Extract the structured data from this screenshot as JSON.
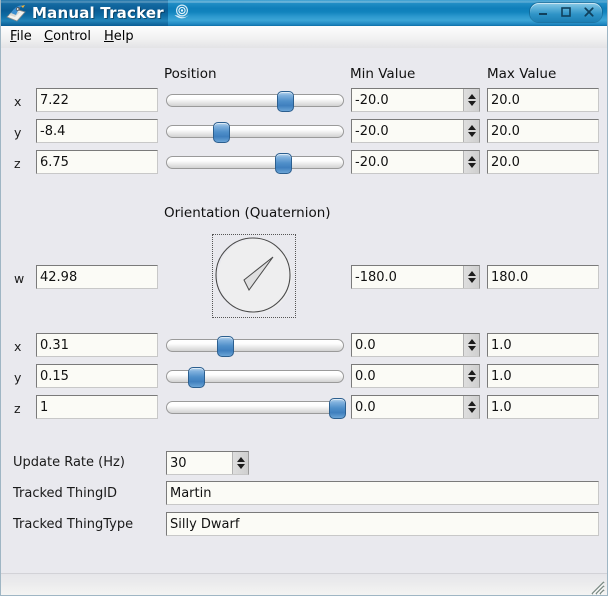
{
  "window": {
    "title": "Manual Tracker",
    "app_icon": "tracker-app-icon",
    "decoration_icon": "swirl-icon",
    "buttons": {
      "minimize": "minimize-icon",
      "maximize": "maximize-icon",
      "close": "close-icon"
    }
  },
  "menubar": {
    "items": [
      {
        "label": "File",
        "mnemonic": "F",
        "rest": "ile"
      },
      {
        "label": "Control",
        "mnemonic": "C",
        "rest": "ontrol"
      },
      {
        "label": "Help",
        "mnemonic": "H",
        "rest": "elp"
      }
    ]
  },
  "headers": {
    "position": "Position",
    "min_value": "Min Value",
    "max_value": "Max Value",
    "orientation": "Orientation (Quaternion)"
  },
  "position": {
    "rows": [
      {
        "axis": "x",
        "value": "7.22",
        "min": "-20.0",
        "max": "20.0",
        "slider_pct": 68
      },
      {
        "axis": "y",
        "value": "-8.4",
        "min": "-20.0",
        "max": "20.0",
        "slider_pct": 29
      },
      {
        "axis": "z",
        "value": "6.75",
        "min": "-20.0",
        "max": "20.0",
        "slider_pct": 67
      }
    ]
  },
  "orientation": {
    "w_row": {
      "axis": "w",
      "value": "42.98",
      "min": "-180.0",
      "max": "180.0"
    },
    "dial": {
      "name": "orientation-dial",
      "needle_angle_deg": 45
    },
    "rows": [
      {
        "axis": "x",
        "value": "0.31",
        "min": "0.0",
        "max": "1.0",
        "slider_pct": 31
      },
      {
        "axis": "y",
        "value": "0.15",
        "min": "0.0",
        "max": "1.0",
        "slider_pct": 15
      },
      {
        "axis": "z",
        "value": "1",
        "min": "0.0",
        "max": "1.0",
        "slider_pct": 100
      }
    ]
  },
  "settings": {
    "update_rate_label": "Update Rate (Hz)",
    "update_rate_value": "30",
    "thing_id_label": "Tracked ThingID",
    "thing_id_value": "Martin",
    "thing_type_label": "Tracked ThingType",
    "thing_type_value": "Silly Dwarf"
  },
  "colors": {
    "title_blue": "#0f7fba",
    "panel_bg": "#e9e9ee",
    "field_bg": "#fbfbf6",
    "slider_thumb": "#4f8fc9"
  }
}
